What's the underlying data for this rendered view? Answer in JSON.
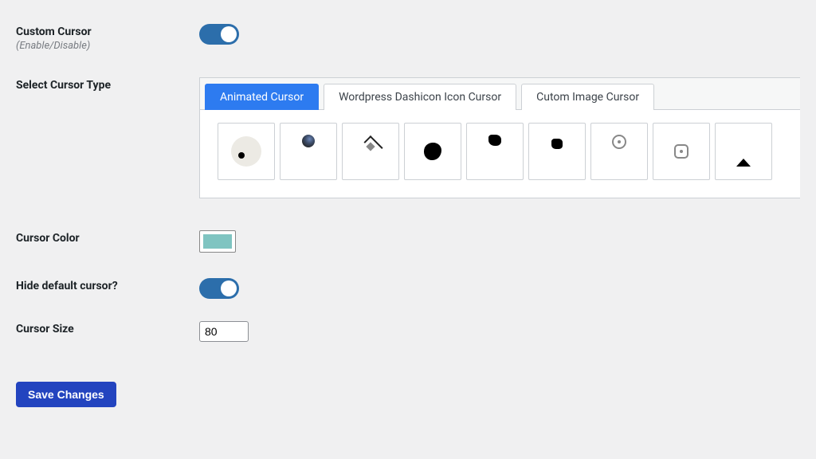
{
  "fields": {
    "custom_cursor": {
      "label": "Custom Cursor",
      "sublabel": "(Enable/Disable)",
      "enabled": true
    },
    "select_type": {
      "label": "Select Cursor Type",
      "tabs": [
        {
          "label": "Animated Cursor",
          "active": true
        },
        {
          "label": "Wordpress Dashicon Icon Cursor",
          "active": false
        },
        {
          "label": "Cutom Image Cursor",
          "active": false
        }
      ],
      "options": [
        {
          "name": "circle-dot"
        },
        {
          "name": "dark-globe"
        },
        {
          "name": "chevron-diamond"
        },
        {
          "name": "blob-large"
        },
        {
          "name": "blob-small-1"
        },
        {
          "name": "blob-small-2"
        },
        {
          "name": "ring-dot"
        },
        {
          "name": "rounded-square-dot"
        },
        {
          "name": "triangle-up"
        }
      ]
    },
    "cursor_color": {
      "label": "Cursor Color",
      "value": "#7fc4c1"
    },
    "hide_default": {
      "label": "Hide default cursor?",
      "enabled": true
    },
    "cursor_size": {
      "label": "Cursor Size",
      "value": "80"
    }
  },
  "actions": {
    "save_label": "Save Changes"
  }
}
